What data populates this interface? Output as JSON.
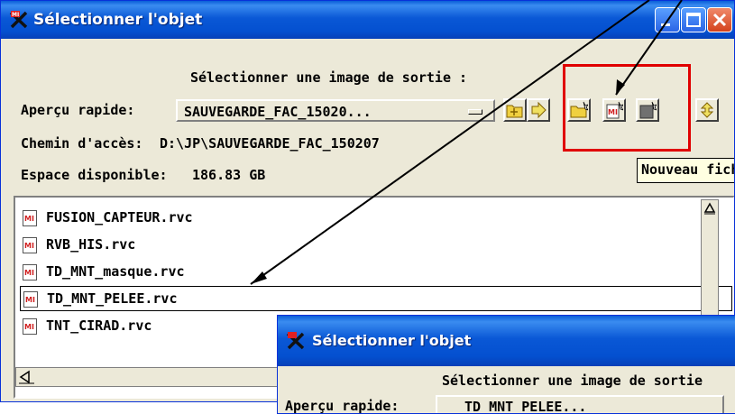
{
  "main_window": {
    "title": "Sélectionner l'objet",
    "heading": "Sélectionner une image de sortie :",
    "quick_preview_label": "Aperçu rapide:",
    "quick_preview_value": "SAUVEGARDE_FAC_15020...",
    "path_label": "Chemin d'accès:",
    "path_value": "D:\\JP\\SAUVEGARDE_FAC_150207",
    "space_label": "Espace disponible:",
    "space_value": "186.83 GB",
    "tooltip": "Nouveau fichier",
    "files": [
      {
        "name": "FUSION_CAPTEUR.rvc"
      },
      {
        "name": "RVB_HIS.rvc"
      },
      {
        "name": "TD_MNT_masque.rvc"
      },
      {
        "name": "TD_MNT_PELEE.rvc"
      },
      {
        "name": "TNT_CIRAD.rvc"
      }
    ],
    "selected_index": 3
  },
  "second_window": {
    "title": "Sélectionner l'objet",
    "heading": "Sélectionner une image de sortie",
    "quick_preview_label": "Aperçu rapide:",
    "quick_preview_value": "TD_MNT_PELEE..."
  },
  "colors": {
    "titlebar": "#0a58d6",
    "window_bg": "#ece9d8",
    "highlight_box": "#e00000",
    "tooltip_bg": "#ffffe1"
  }
}
